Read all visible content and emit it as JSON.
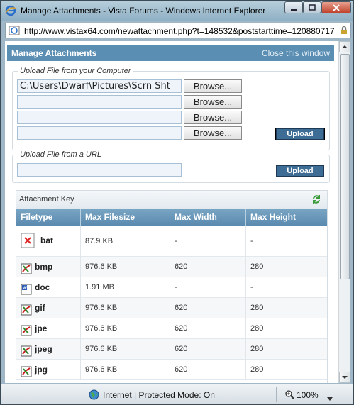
{
  "window": {
    "title": "Manage Attachments - Vista Forums - Windows Internet Explorer",
    "address": "http://www.vistax64.com/newattachment.php?t=148532&poststarttime=120880717"
  },
  "header": {
    "title": "Manage Attachments",
    "close_label": "Close this window"
  },
  "upload_computer": {
    "legend": "Upload File from your Computer",
    "files": [
      {
        "value": "C:\\Users\\Dwarf\\Pictures\\Scrn Sht",
        "browse_label": "Browse..."
      },
      {
        "value": "",
        "browse_label": "Browse..."
      },
      {
        "value": "",
        "browse_label": "Browse..."
      },
      {
        "value": "",
        "browse_label": "Browse..."
      }
    ],
    "upload_label": "Upload"
  },
  "upload_url": {
    "legend": "Upload File from a URL",
    "value": "",
    "upload_label": "Upload"
  },
  "attachment_key": {
    "title": "Attachment Key",
    "columns": [
      "Filetype",
      "Max Filesize",
      "Max Width",
      "Max Height"
    ],
    "rows": [
      {
        "type": "bat",
        "icon": "bat-file-icon",
        "size": "87.9 KB",
        "width": "-",
        "height": "-"
      },
      {
        "type": "bmp",
        "icon": "image-file-icon",
        "size": "976.6 KB",
        "width": "620",
        "height": "280"
      },
      {
        "type": "doc",
        "icon": "word-doc-icon",
        "size": "1.91 MB",
        "width": "-",
        "height": "-"
      },
      {
        "type": "gif",
        "icon": "image-file-icon",
        "size": "976.6 KB",
        "width": "620",
        "height": "280"
      },
      {
        "type": "jpe",
        "icon": "image-file-icon",
        "size": "976.6 KB",
        "width": "620",
        "height": "280"
      },
      {
        "type": "jpeg",
        "icon": "image-file-icon",
        "size": "976.6 KB",
        "width": "620",
        "height": "280"
      },
      {
        "type": "jpg",
        "icon": "image-file-icon",
        "size": "976.6 KB",
        "width": "620",
        "height": "280"
      }
    ]
  },
  "status": {
    "zone_text": "Internet | Protected Mode: On",
    "zoom": "100%"
  },
  "colors": {
    "header_bg": "#5b8eb3",
    "upload_button": "#3d6d94",
    "table_header": "#6f9bbd"
  }
}
